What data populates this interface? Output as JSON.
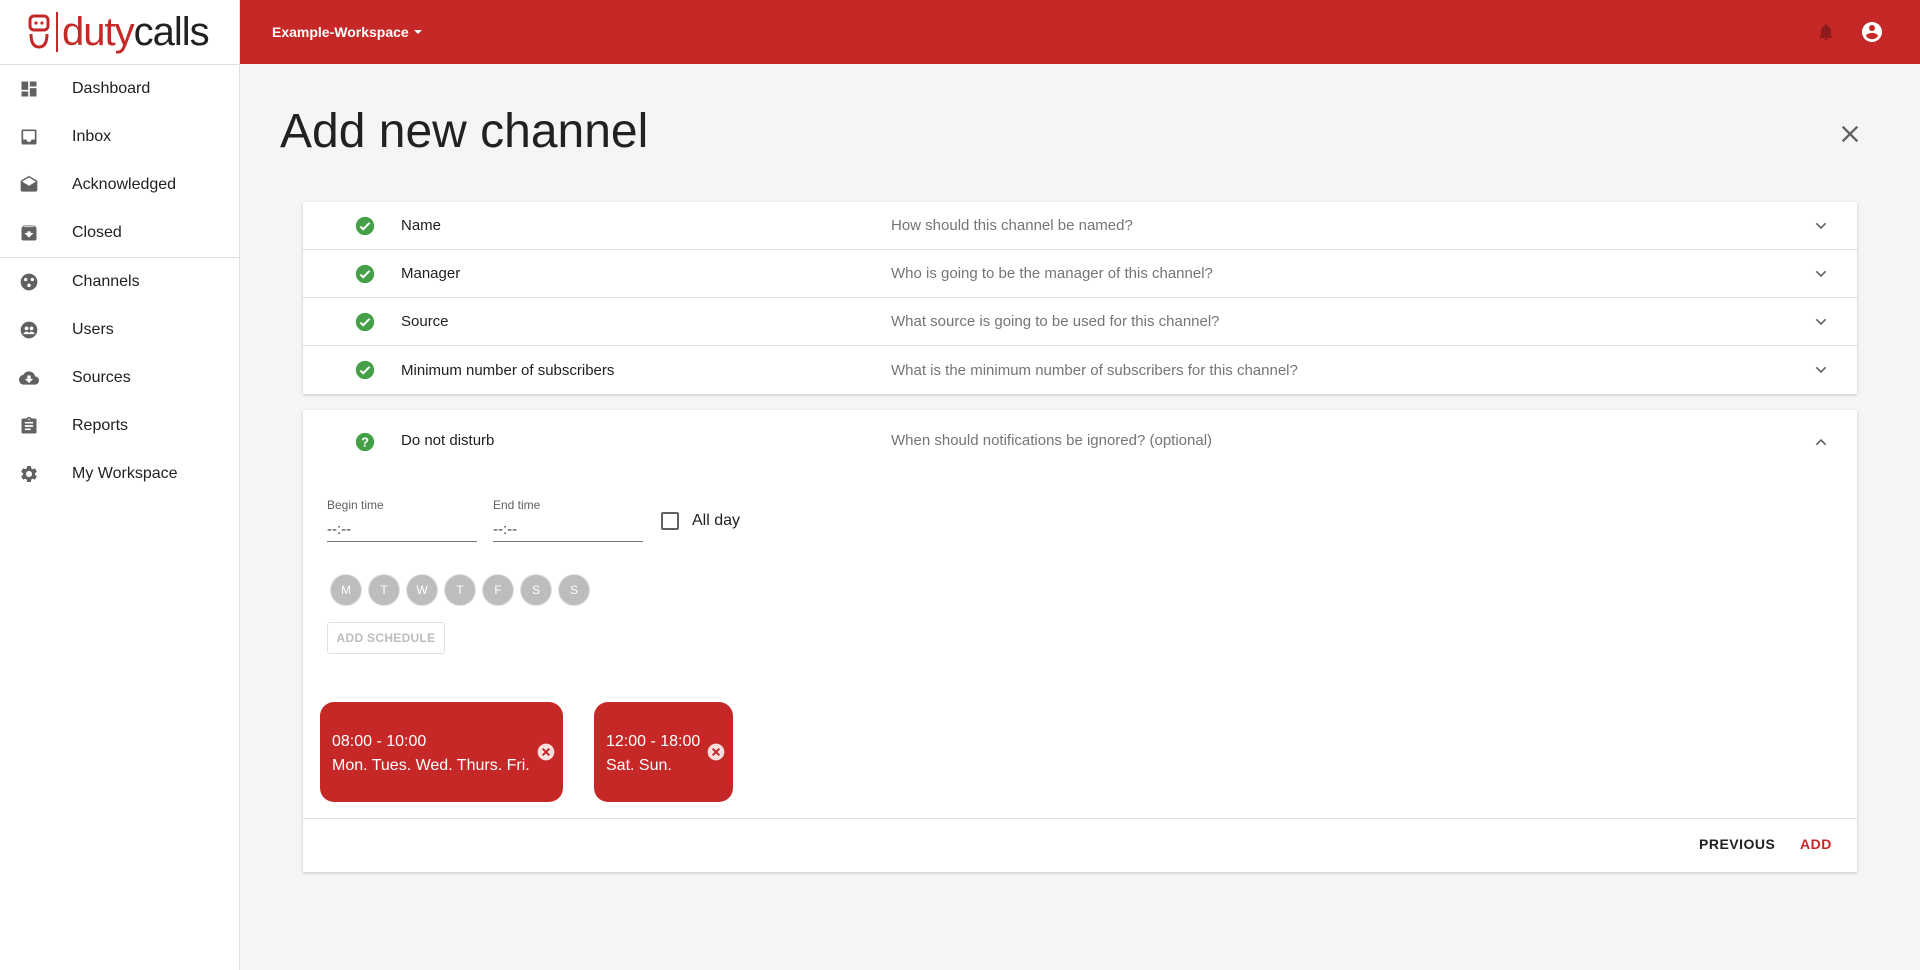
{
  "brand": {
    "name_part1": "duty",
    "name_part2": "calls",
    "accent": "#c62828"
  },
  "header": {
    "workspace": "Example-Workspace",
    "icons": [
      "bell-icon",
      "account-circle-icon"
    ]
  },
  "sidebar": {
    "group1": [
      {
        "label": "Dashboard",
        "icon": "dashboard-icon"
      },
      {
        "label": "Inbox",
        "icon": "inbox-icon"
      },
      {
        "label": "Acknowledged",
        "icon": "drafts-icon"
      },
      {
        "label": "Closed",
        "icon": "archive-icon"
      }
    ],
    "group2": [
      {
        "label": "Channels",
        "icon": "channels-icon"
      },
      {
        "label": "Users",
        "icon": "users-icon"
      },
      {
        "label": "Sources",
        "icon": "cloud-download-icon"
      },
      {
        "label": "Reports",
        "icon": "clipboard-icon"
      },
      {
        "label": "My Workspace",
        "icon": "gear-icon"
      }
    ]
  },
  "main": {
    "title": "Add new channel",
    "steps": [
      {
        "title": "Name",
        "desc": "How should this channel be named?",
        "status": "complete"
      },
      {
        "title": "Manager",
        "desc": "Who is going to be the manager of this channel?",
        "status": "complete"
      },
      {
        "title": "Source",
        "desc": "What source is going to be used for this channel?",
        "status": "complete"
      },
      {
        "title": "Minimum number of subscribers",
        "desc": "What is the minimum number of subscribers for this channel?",
        "status": "complete"
      }
    ],
    "dnd": {
      "title": "Do not disturb",
      "desc": "When should notifications be ignored? (optional)",
      "begin_label": "Begin time",
      "begin_value": "--:--",
      "end_label": "End time",
      "end_value": "--:--",
      "allday_label": "All day",
      "days": [
        "M",
        "T",
        "W",
        "T",
        "F",
        "S",
        "S"
      ],
      "add_schedule": "ADD SCHEDULE",
      "schedules": [
        {
          "time": "08:00 - 10:00",
          "days": "Mon. Tues. Wed. Thurs. Fri."
        },
        {
          "time": "12:00 - 18:00",
          "days": "Sat. Sun."
        }
      ],
      "previous": "PREVIOUS",
      "add": "ADD"
    }
  }
}
